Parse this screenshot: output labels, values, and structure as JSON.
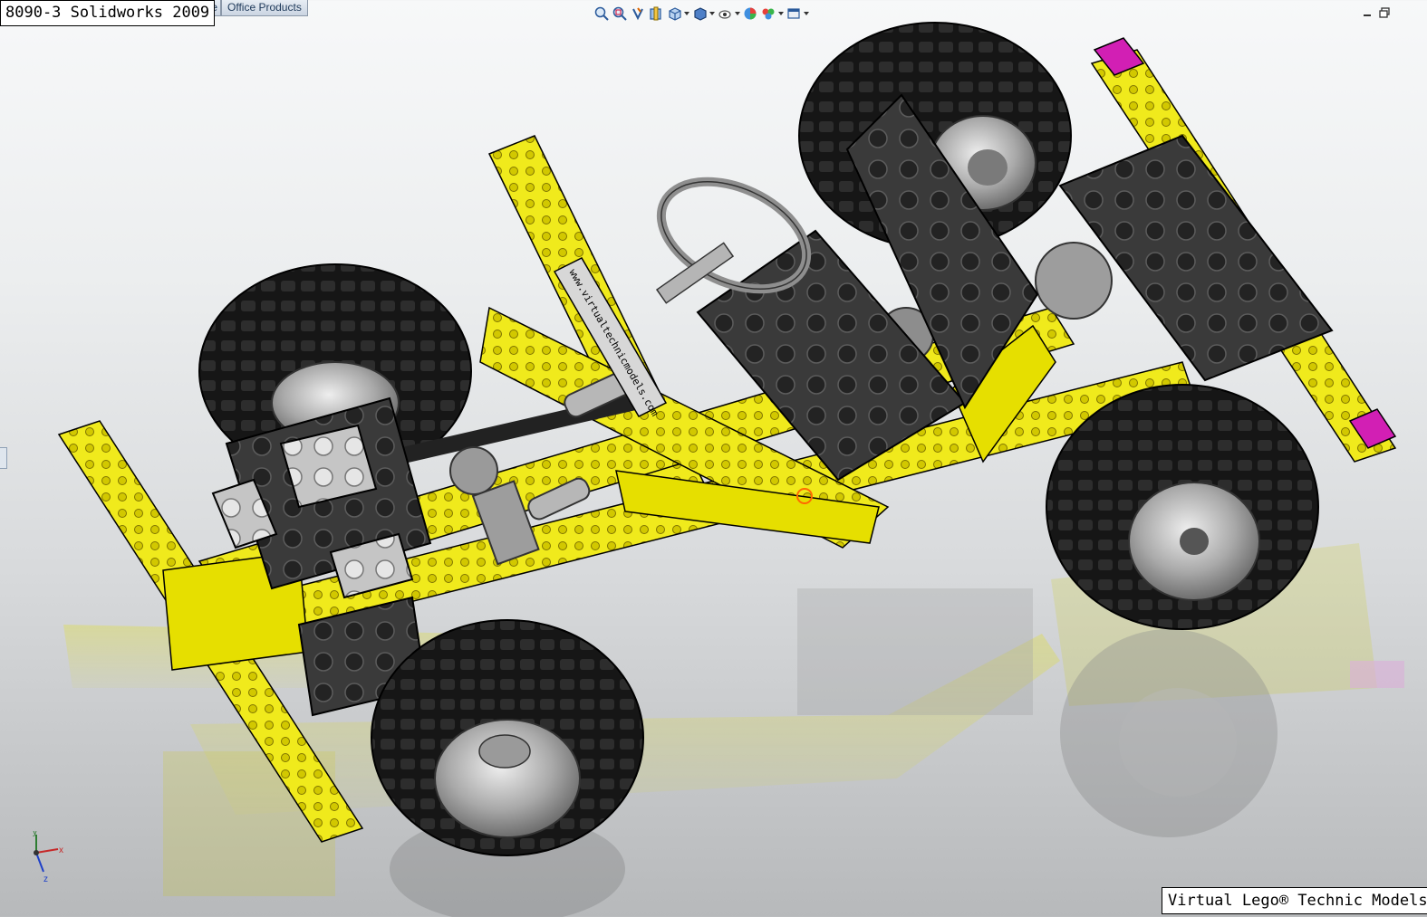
{
  "document": {
    "title": "8090-3 Solidworks 2009"
  },
  "task_pane_tabs": [
    {
      "label": "te"
    },
    {
      "label": "Office Products"
    }
  ],
  "heads_up_toolbar": {
    "buttons": [
      {
        "icon": "zoom-to-fit-icon"
      },
      {
        "icon": "zoom-to-area-icon"
      },
      {
        "icon": "previous-view-icon"
      },
      {
        "icon": "section-view-icon"
      },
      {
        "icon": "view-orientation-icon"
      },
      {
        "icon": "display-style-icon"
      },
      {
        "icon": "hide-show-items-icon"
      },
      {
        "icon": "edit-appearance-icon"
      },
      {
        "icon": "apply-scene-icon"
      },
      {
        "icon": "view-settings-icon"
      }
    ]
  },
  "window_controls": [
    {
      "icon": "minimize-icon"
    },
    {
      "icon": "restore-icon"
    }
  ],
  "model_name_label": "www.virtualtechnicmodels.com",
  "triad": {
    "x": "x",
    "y": "y",
    "z": "z"
  },
  "watermark": "Virtual Lego® Technic Models",
  "colors": {
    "beam": "#f0ea1c",
    "beam_shadow": "#b8ad00",
    "tire": "#141414",
    "plate_dark": "#3b3b3b",
    "plate_light": "#c9c9c9",
    "accent_magenta": "#d01fb3",
    "rim": "#a7a7a7"
  }
}
